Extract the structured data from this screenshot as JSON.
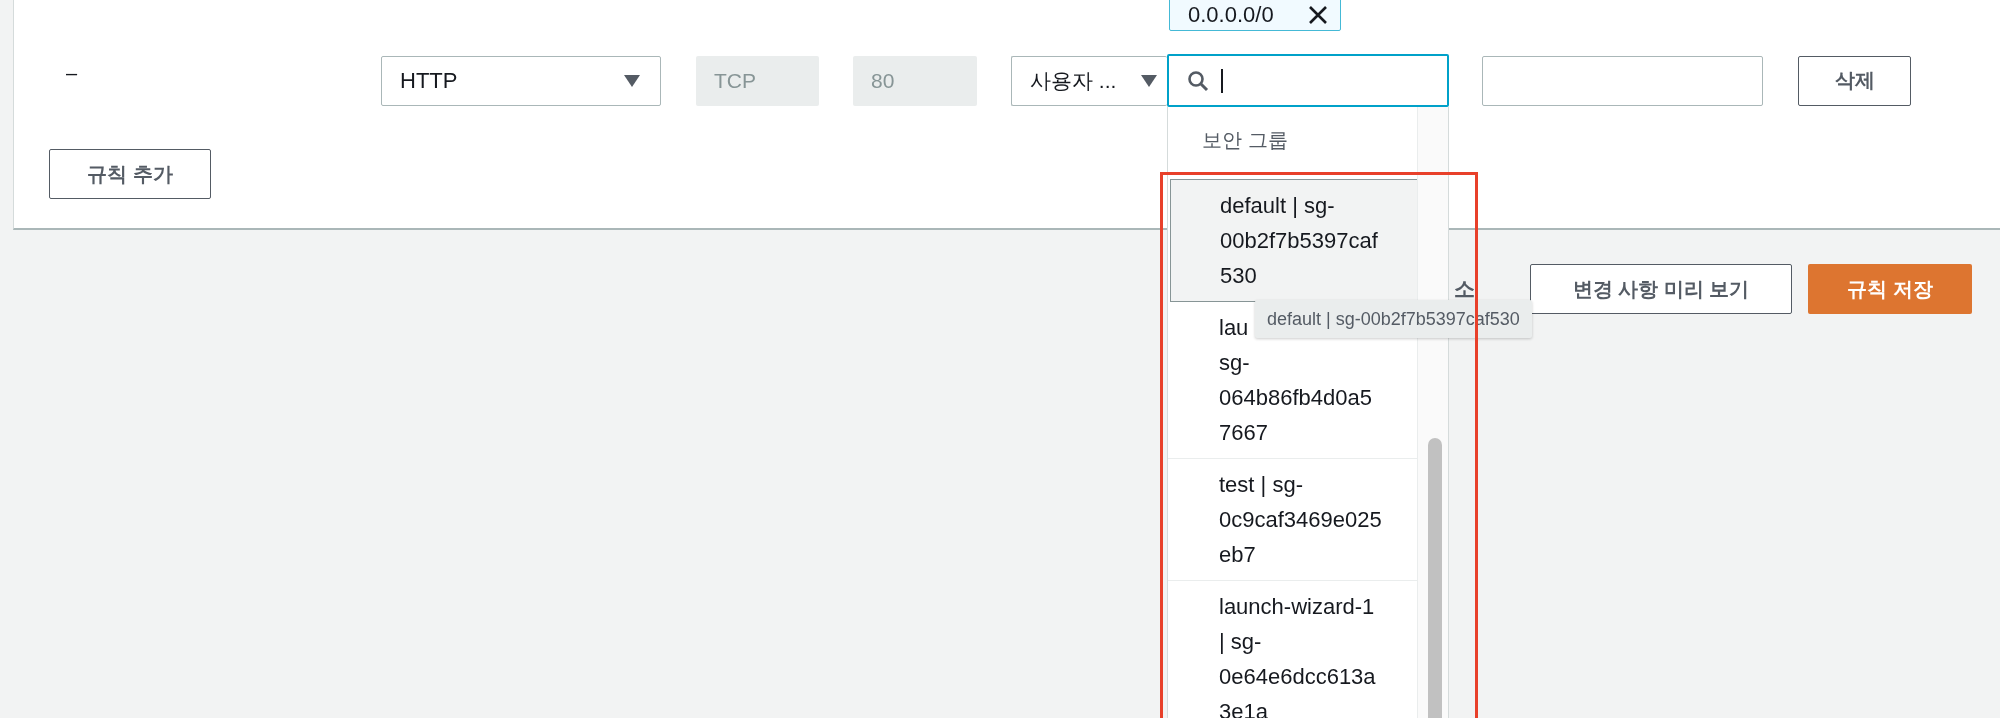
{
  "rule": {
    "dash": "–",
    "type": "HTTP",
    "protocol": "TCP",
    "port_range": "80",
    "source_type": "사용자 ...",
    "source_chip": "0.0.0.0/0",
    "delete": "삭제"
  },
  "add_rule": "규칙 추가",
  "footer": {
    "cancel": "소",
    "preview": "변경 사항 미리 보기",
    "save": "규칙 저장"
  },
  "dropdown": {
    "group_label": "보안 그룹",
    "options": [
      {
        "label": "default | sg-\n00b2f7b5397caf\n530",
        "highlighted": true
      },
      {
        "label": "lau\nsg-\n064b86fb4d0a5\n7667",
        "highlighted": false
      },
      {
        "label": "test | sg-\n0c9caf3469e025\neb7",
        "highlighted": false
      },
      {
        "label": "launch-wizard-1\n| sg-\n0e64e6dcc613a\n3e1a",
        "highlighted": false
      }
    ]
  },
  "tooltip": "default | sg-00b2f7b5397caf530"
}
